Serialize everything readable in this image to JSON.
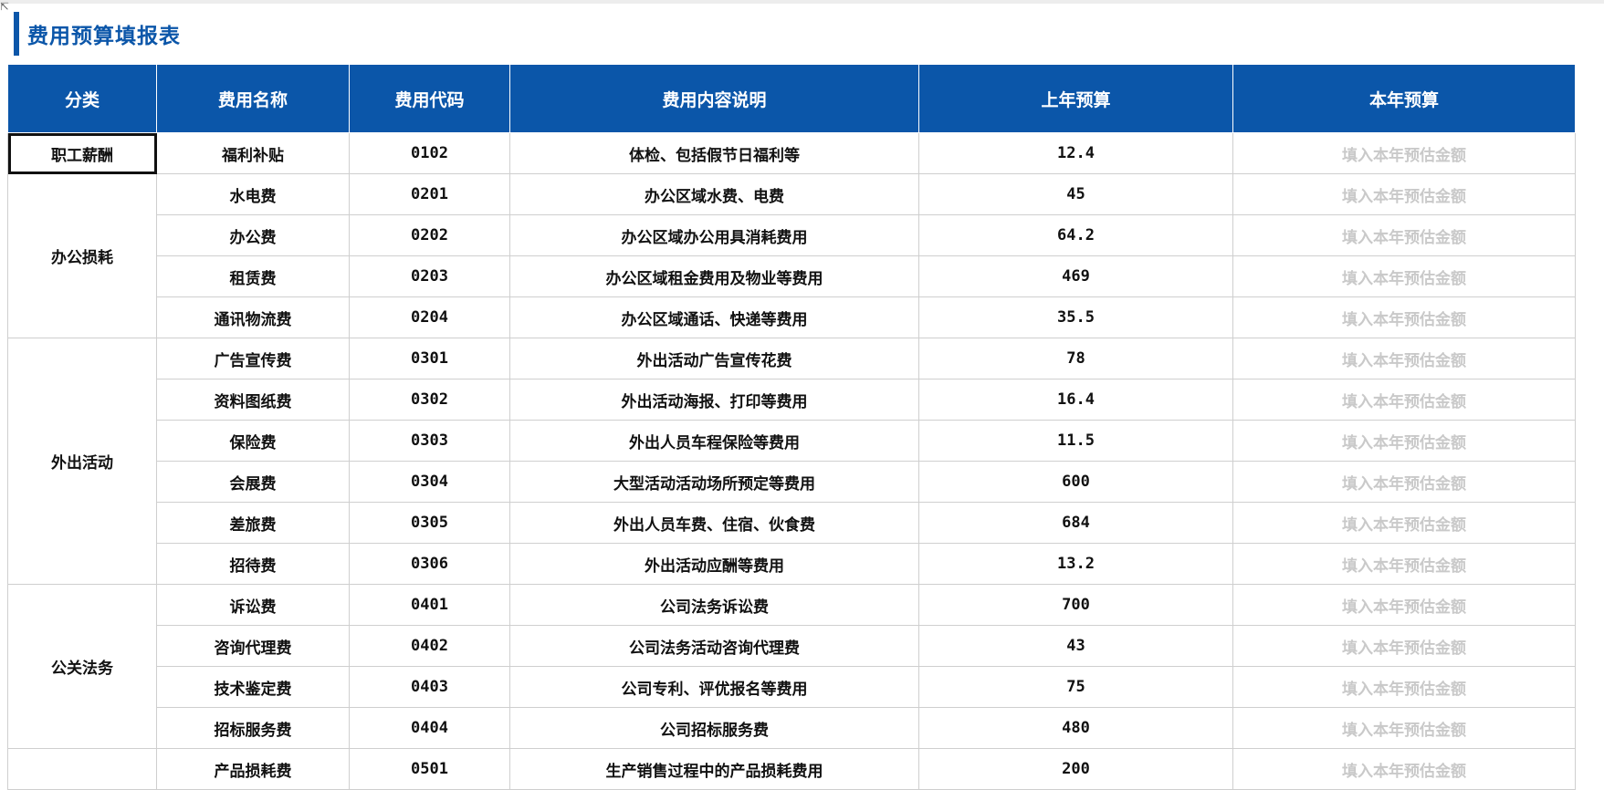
{
  "page_title": "费用预算填报表",
  "colors": {
    "accent": "#0b56a9",
    "header_text": "#ffffff",
    "placeholder": "#c9c9c9"
  },
  "headers": [
    "分类",
    "费用名称",
    "费用代码",
    "费用内容说明",
    "上年预算",
    "本年预算"
  ],
  "placeholder": "填入本年预估金额",
  "groups": [
    {
      "category": "职工薪酬",
      "selected": true,
      "rows": [
        {
          "name": "福利补贴",
          "code": "0102",
          "desc": "体检、包括假节日福利等",
          "last_year": "12.4"
        }
      ]
    },
    {
      "category": "办公损耗",
      "rows": [
        {
          "name": "水电费",
          "code": "0201",
          "desc": "办公区域水费、电费",
          "last_year": "45"
        },
        {
          "name": "办公费",
          "code": "0202",
          "desc": "办公区域办公用具消耗费用",
          "last_year": "64.2"
        },
        {
          "name": "租赁费",
          "code": "0203",
          "desc": "办公区域租金费用及物业等费用",
          "last_year": "469"
        },
        {
          "name": "通讯物流费",
          "code": "0204",
          "desc": "办公区域通话、快递等费用",
          "last_year": "35.5"
        }
      ]
    },
    {
      "category": "外出活动",
      "rows": [
        {
          "name": "广告宣传费",
          "code": "0301",
          "desc": "外出活动广告宣传花费",
          "last_year": "78"
        },
        {
          "name": "资料图纸费",
          "code": "0302",
          "desc": "外出活动海报、打印等费用",
          "last_year": "16.4"
        },
        {
          "name": "保险费",
          "code": "0303",
          "desc": "外出人员车程保险等费用",
          "last_year": "11.5"
        },
        {
          "name": "会展费",
          "code": "0304",
          "desc": "大型活动活动场所预定等费用",
          "last_year": "600"
        },
        {
          "name": "差旅费",
          "code": "0305",
          "desc": "外出人员车费、住宿、伙食费",
          "last_year": "684"
        },
        {
          "name": "招待费",
          "code": "0306",
          "desc": "外出活动应酬等费用",
          "last_year": "13.2"
        }
      ]
    },
    {
      "category": "公关法务",
      "rows": [
        {
          "name": "诉讼费",
          "code": "0401",
          "desc": "公司法务诉讼费",
          "last_year": "700"
        },
        {
          "name": "咨询代理费",
          "code": "0402",
          "desc": "公司法务活动咨询代理费",
          "last_year": "43"
        },
        {
          "name": "技术鉴定费",
          "code": "0403",
          "desc": "公司专利、评优报名等费用",
          "last_year": "75"
        },
        {
          "name": "招标服务费",
          "code": "0404",
          "desc": "公司招标服务费",
          "last_year": "480"
        }
      ]
    },
    {
      "category": "",
      "rows": [
        {
          "name": "产品损耗费",
          "code": "0501",
          "desc": "生产销售过程中的产品损耗费用",
          "last_year": "200"
        }
      ]
    }
  ]
}
